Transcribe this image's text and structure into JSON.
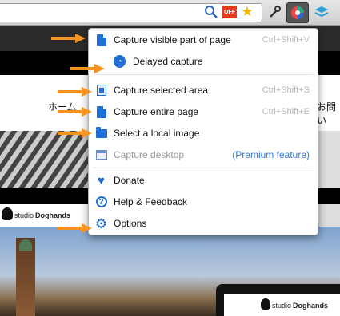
{
  "toolbar": {
    "icons": [
      "magnifier-icon",
      "off-badge-icon",
      "star-icon",
      "wrench-icon",
      "screenshot-extension-icon",
      "layers-icon"
    ],
    "off_label": "OFF"
  },
  "page": {
    "nav_text_left": "ホーム",
    "nav_text_right": "お問い",
    "brand_studio": "studio",
    "brand_name": "Doghands"
  },
  "menu": {
    "items": [
      {
        "label": "Capture visible part of page",
        "shortcut": "Ctrl+Shift+V",
        "icon": "document-icon"
      },
      {
        "label": "Delayed capture",
        "shortcut": "",
        "icon": "clock-icon"
      },
      {
        "label": "Capture selected area",
        "shortcut": "Ctrl+Shift+S",
        "icon": "selection-icon"
      },
      {
        "label": "Capture entire page",
        "shortcut": "Ctrl+Shift+E",
        "icon": "document-icon"
      },
      {
        "label": "Select a local image",
        "shortcut": "",
        "icon": "folder-icon"
      },
      {
        "label": "Capture desktop",
        "premium": "(Premium feature)",
        "icon": "desktop-icon"
      },
      {
        "label": "Donate",
        "icon": "heart-icon"
      },
      {
        "label": "Help & Feedback",
        "icon": "help-icon"
      },
      {
        "label": "Options",
        "icon": "gear-icon"
      }
    ]
  },
  "colors": {
    "accent": "#1f6fd6",
    "arrow": "#f5931e",
    "premium": "#2e7ad8"
  }
}
